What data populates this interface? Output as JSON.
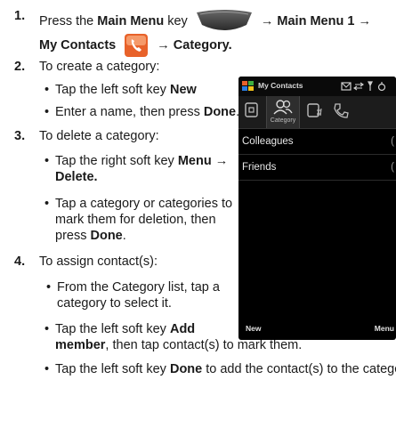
{
  "steps": [
    {
      "number": "1.",
      "pre": "Press the",
      "key": "Main Menu",
      "mid": "key",
      "menu_path": "→ Main Menu 1 →",
      "line2": "My Contacts",
      "end": "→ Category."
    },
    {
      "number": "2.",
      "text": "To create a category:"
    },
    {
      "number": "3.",
      "text": "To delete a category:"
    },
    {
      "number": "4.",
      "text": "To assign contact(s):"
    }
  ],
  "bullets": {
    "create_1_pre": "Tap the left soft key ",
    "create_1_bold": "New",
    "create_2_pre": "Enter a name, then press ",
    "create_2_bold": "Done",
    "create_2_post": ".",
    "delete_1_pre": "Tap the right soft key ",
    "delete_1_bold": "Menu →",
    "delete_1_bold2": "Delete.",
    "delete_2_l1": "Tap a category or categories to",
    "delete_2_l2": "mark them for deletion, then",
    "delete_2_l3_pre": "press ",
    "delete_2_l3_bold": "Done",
    "delete_2_l3_post": ".",
    "assign_1_l1": "From the Category list, tap a",
    "assign_1_l2": "category to select it.",
    "assign_2_pre": "Tap the left soft key ",
    "assign_2_bold": "Add",
    "assign_2_l2_bold": "member",
    "assign_2_l2_post": ", then tap contact(s) to mark them.",
    "assign_3_pre": "Tap the left soft key ",
    "assign_3_bold": "Done",
    "assign_3_post": " to add the contact(s) to the category."
  },
  "phone": {
    "title": "My Contacts",
    "tab_label": "Category",
    "rows": [
      "Colleagues",
      "Friends"
    ],
    "row_counts": [
      "(",
      "("
    ],
    "soft_left": "New",
    "soft_right": "Menu"
  },
  "colors": {
    "accent_orange": "#e8622a",
    "phone_bg": "#000000"
  },
  "icons": [
    "main-menu-key-icon",
    "contacts-icon",
    "windows-flag-icon",
    "status-icons"
  ]
}
